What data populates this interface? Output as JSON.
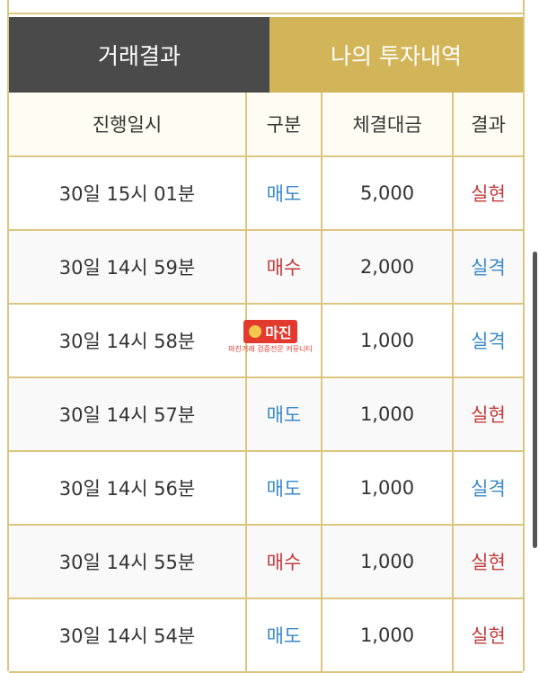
{
  "tabs": [
    {
      "label": "거래결과",
      "active": true
    },
    {
      "label": "나의 투자내역",
      "active": false
    }
  ],
  "table": {
    "headers": [
      "진행일시",
      "구분",
      "체결대금",
      "결과"
    ],
    "rows": [
      {
        "time": "30일 15시 01분",
        "type": "매도",
        "amount": "5,000",
        "result": "실현"
      },
      {
        "time": "30일 14시 59분",
        "type": "매수",
        "amount": "2,000",
        "result": "실격"
      },
      {
        "time": "30일 14시 58분",
        "type": "",
        "amount": "1,000",
        "result": "실격"
      },
      {
        "time": "30일 14시 57분",
        "type": "매도",
        "amount": "1,000",
        "result": "실현"
      },
      {
        "time": "30일 14시 56분",
        "type": "매도",
        "amount": "1,000",
        "result": "실격"
      },
      {
        "time": "30일 14시 55분",
        "type": "매수",
        "amount": "1,000",
        "result": "실현"
      },
      {
        "time": "30일 14시 54분",
        "type": "매도",
        "amount": "1,000",
        "result": "실현"
      }
    ]
  },
  "watermark": {
    "title": "마진",
    "subtitle": "마진거래 검증전문 커뮤니티"
  },
  "colors": {
    "gold": "#d2b559",
    "dark": "#4a4a4a",
    "sell": "#3a8ac8",
    "buy": "#c43a3a"
  }
}
